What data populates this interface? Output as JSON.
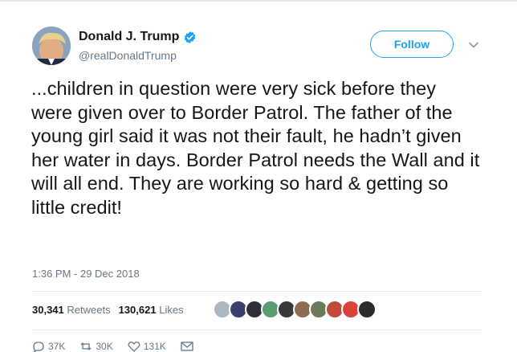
{
  "user": {
    "name": "Donald J. Trump",
    "handle": "@realDonaldTrump"
  },
  "follow_label": "Follow",
  "tweet": {
    "text": "...children in question were very sick before they were given over to Border Patrol. The father of the young girl said it was not their fault, he hadn’t given her water in days. Border Patrol needs the Wall and it will all end. They are working so hard & getting so little credit!",
    "timestamp": "1:36 PM - 29 Dec 2018"
  },
  "stats": {
    "retweets_count": "30,341",
    "retweets_label": "Retweets",
    "likes_count": "130,621",
    "likes_label": "Likes"
  },
  "likers_colors": [
    "#aab8c2",
    "#3b3f6b",
    "#2d2f3a",
    "#5a9e6f",
    "#38393d",
    "#8c6d52",
    "#6c7a5a",
    "#c24a3a",
    "#d9433b",
    "#2b2b2b"
  ],
  "actions": {
    "reply_count": "37K",
    "retweet_count": "30K",
    "like_count": "131K"
  },
  "colors": {
    "accent": "#1da1f2",
    "text": "#14171a",
    "secondary": "#657786"
  }
}
